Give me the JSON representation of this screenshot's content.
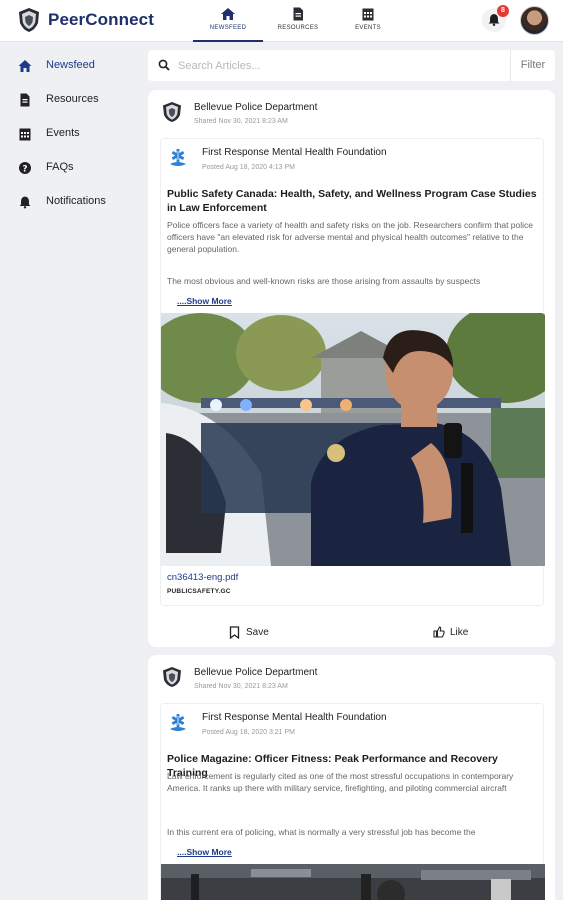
{
  "app": {
    "name": "PeerConnect"
  },
  "topnav": [
    {
      "label": "NEWSFEED",
      "icon": "home-icon",
      "active": true
    },
    {
      "label": "RESOURCES",
      "icon": "document-icon",
      "active": false
    },
    {
      "label": "EVENTS",
      "icon": "calendar-icon",
      "active": false
    }
  ],
  "notifications": {
    "count": "8"
  },
  "sidebar": {
    "items": [
      {
        "label": "Newsfeed",
        "icon": "home-icon",
        "active": true
      },
      {
        "label": "Resources",
        "icon": "document-icon",
        "active": false
      },
      {
        "label": "Events",
        "icon": "calendar-icon",
        "active": false
      },
      {
        "label": "FAQs",
        "icon": "question-icon",
        "active": false
      },
      {
        "label": "Notifications",
        "icon": "bell-icon",
        "active": false
      }
    ]
  },
  "search": {
    "placeholder": "Search Articles...",
    "filter_label": "Filter"
  },
  "posts": [
    {
      "author": "Bellevue Police Department",
      "shared": "Shared Nov 30, 2021 8:23 AM",
      "org": "First Response Mental Health Foundation",
      "posted": "Posted Aug 18, 2020 4:13 PM",
      "title": "Public Safety Canada: Health, Safety, and Wellness Program Case Studies in Law Enforcement",
      "body": "Police officers face a variety of health and safety risks on the job. Researchers confirm that police officers have \"an elevated risk for adverse mental and physical health outcomes\" relative to the general population.",
      "body2": "The most obvious and well-known risks are those arising from assaults by suspects",
      "show_more": "....Show More",
      "attachment": "cn36413-eng.pdf",
      "source": "PUBLICSAFETY.GC",
      "save_label": "Save",
      "like_label": "Like"
    },
    {
      "author": "Bellevue Police Department",
      "shared": "Shared Nov 30, 2021 8:23 AM",
      "org": "First Response Mental Health Foundation",
      "posted": "Posted Aug 18, 2020 3:21 PM",
      "title": "Police Magazine: Officer Fitness: Peak Performance and Recovery Training",
      "body": "Law enforcement is regularly cited as one of the most stressful occupations in contemporary America. It ranks up there with military service, firefighting, and piloting commercial aircraft",
      "body2": "In this current era of policing, what is normally a very stressful job has become the",
      "show_more": "....Show More"
    }
  ],
  "colors": {
    "brand": "#1f2f6b",
    "accent": "#1f3a8a",
    "badge": "#e53935"
  }
}
